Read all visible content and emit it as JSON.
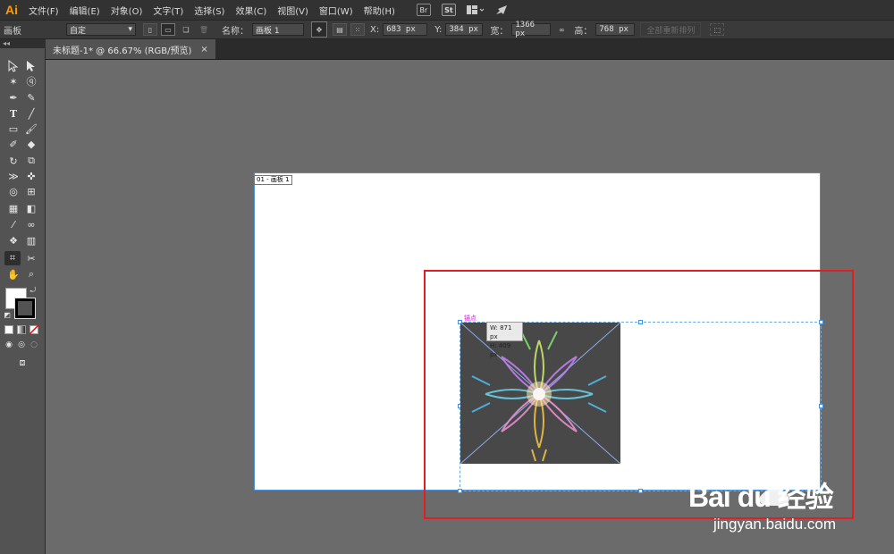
{
  "app": {
    "logo": "Ai"
  },
  "menu": [
    "文件(F)",
    "编辑(E)",
    "对象(O)",
    "文字(T)",
    "选择(S)",
    "效果(C)",
    "视图(V)",
    "窗口(W)",
    "帮助(H)"
  ],
  "menubar_icons": {
    "br": "Br",
    "st": "St"
  },
  "control": {
    "panel_label": "画板",
    "preset_value": "自定",
    "name_label": "名称：",
    "name_value": "画板 1",
    "x_label": "X:",
    "x_value": "683 px",
    "y_label": "Y:",
    "y_value": "384 px",
    "w_label": "宽：",
    "w_value": "1366 px",
    "h_label": "高：",
    "h_value": "768 px",
    "rearrange_label": "全部重新排列"
  },
  "document": {
    "tab_title": "未标题-1* @ 66.67% (RGB/预览)",
    "close_glyph": "×",
    "panel_collapse": "◂◂"
  },
  "canvas": {
    "artboard_label": "01 - 画板 1",
    "anchor_label": "锚点",
    "tooltip_w": "W: 871 px",
    "tooltip_h": "H: 409 px"
  },
  "watermark": {
    "brand": "Bai du 经验",
    "url": "jingyan.baidu.com"
  },
  "colors": {
    "accent_red": "#e02020",
    "selection_blue": "#4a90d9",
    "anchor_magenta": "#e020e0"
  }
}
